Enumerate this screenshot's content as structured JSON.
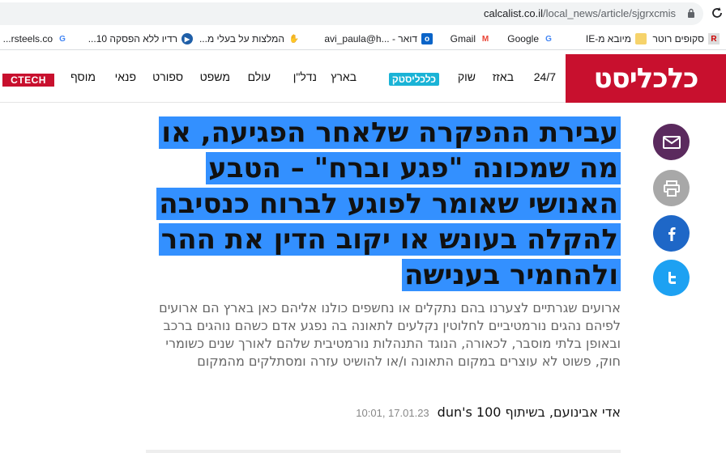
{
  "browser": {
    "url_host": "calcalist.co.il",
    "url_path": "/local_news/article/sjgrxcmis",
    "bookmarks": [
      {
        "label": "סקופים רוטר",
        "icon": "rotter-icon"
      },
      {
        "label": "מיובא מ-IE",
        "icon": "folder-icon"
      },
      {
        "label": "Google",
        "icon": "google-icon"
      },
      {
        "label": "Gmail",
        "icon": "gmail-icon"
      },
      {
        "label": "דואר - ...avi_paula@h",
        "icon": "outlook-icon"
      },
      {
        "label": "המלצות על בעלי מ...",
        "icon": "handshake-icon"
      },
      {
        "label": "רדיו ללא הפסקה 10...",
        "icon": "play-icon"
      },
      {
        "label": "rsteels.co...",
        "icon": "google-icon"
      }
    ]
  },
  "site": {
    "logo": "כלכליסט",
    "nav": [
      "24/7",
      "באזז",
      "שוק",
      "כלכליסטק",
      "בארץ",
      "נדל\"ן",
      "עולם",
      "משפט",
      "ספורט",
      "פנאי",
      "מוסף"
    ],
    "ctech": "CTECH"
  },
  "article": {
    "headline": "עבירת ההפקרה שלאחר הפגיעה, או מה שמכונה \"פגע וברח\" – הטבע האנושי שאומר לפוגע לברוח כנסיבה להקלה בעונש או יקוב הדין את ההר ולהחמיר בענישה",
    "subtitle": "ארועים שגרתיים לצערנו בהם נתקלים או נחשפים כולנו אליהם כאן בארץ הם ארועים לפיהם נהגים נורמטיביים לחלוטין נקלעים לתאונה בה נפגע אדם כשהם נוהגים ברכב ובאופן בלתי מוסבר, לכאורה, הנוגד התנהלות נורמטיבית שלהם לאורך שנים כשומרי חוק, פשוט לא עוצרים במקום התאונה ו/או להושיט עזרה ומסתלקים מהמקום",
    "author": "אדי אבינועם, בשיתוף dun's 100",
    "datetime": "10:01, 17.01.23"
  },
  "share": {
    "email_color": "#5b2a5e",
    "print_color": "#a8a8a8",
    "facebook_color": "#1e67c7",
    "twitter_color": "#1da1f2"
  }
}
